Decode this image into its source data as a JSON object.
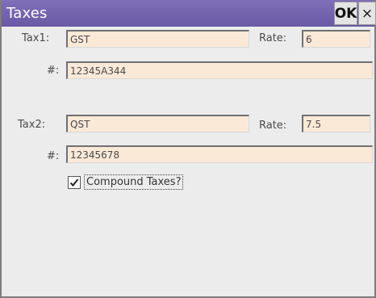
{
  "window": {
    "title": "Taxes",
    "ok_label": "OK",
    "close_label": "×"
  },
  "tax1": {
    "label": "Tax1:",
    "name_value": "GST",
    "rate_label": "Rate:",
    "rate_value": "6",
    "number_label": "#:",
    "number_value": "12345A344"
  },
  "tax2": {
    "label": "Tax2:",
    "name_value": "QST",
    "rate_label": "Rate:",
    "rate_value": "7.5",
    "number_label": "#:",
    "number_value": "12345678"
  },
  "compound": {
    "label": "Compound Taxes?",
    "checked": true
  }
}
